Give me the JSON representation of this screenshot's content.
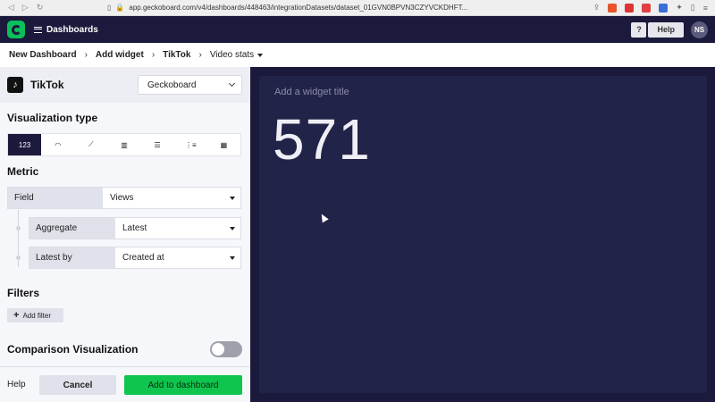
{
  "browser": {
    "url": "app.geckoboard.com/v4/dashboards/448463/integrationDatasets/dataset_01GVN0BPVN3CZYVCKDHFT..."
  },
  "appbar": {
    "menu_label": "Dashboards",
    "question_label": "?",
    "help_label": "Help",
    "avatar_initials": "NS",
    "brand_color": "#0bbf5b"
  },
  "breadcrumb": {
    "items": [
      "New Dashboard",
      "Add widget",
      "TikTok"
    ],
    "current": "Video stats"
  },
  "source": {
    "name": "TikTok",
    "account": "Geckoboard"
  },
  "visualization": {
    "heading": "Visualization type",
    "types": [
      {
        "label": "123",
        "icon": "number-icon",
        "active": true
      },
      {
        "label": "◠",
        "icon": "gauge-icon"
      },
      {
        "label": "⟋",
        "icon": "line-chart-icon"
      },
      {
        "label": "▥",
        "icon": "column-chart-icon"
      },
      {
        "label": "☰",
        "icon": "bar-chart-icon"
      },
      {
        "label": "⋮≡",
        "icon": "leaderboard-icon"
      },
      {
        "label": "▦",
        "icon": "table-icon"
      }
    ]
  },
  "metric": {
    "heading": "Metric",
    "field_label": "Field",
    "field_value": "Views",
    "aggregate_label": "Aggregate",
    "aggregate_value": "Latest",
    "latest_by_label": "Latest by",
    "latest_by_value": "Created at"
  },
  "filters": {
    "heading": "Filters",
    "add_label": "Add filter"
  },
  "comparison": {
    "heading": "Comparison Visualization",
    "enabled": false
  },
  "footer": {
    "help_label": "Help",
    "cancel_label": "Cancel",
    "add_label": "Add to dashboard",
    "add_color": "#10c54e"
  },
  "widget": {
    "title_placeholder": "Add a widget title",
    "value": "571"
  }
}
